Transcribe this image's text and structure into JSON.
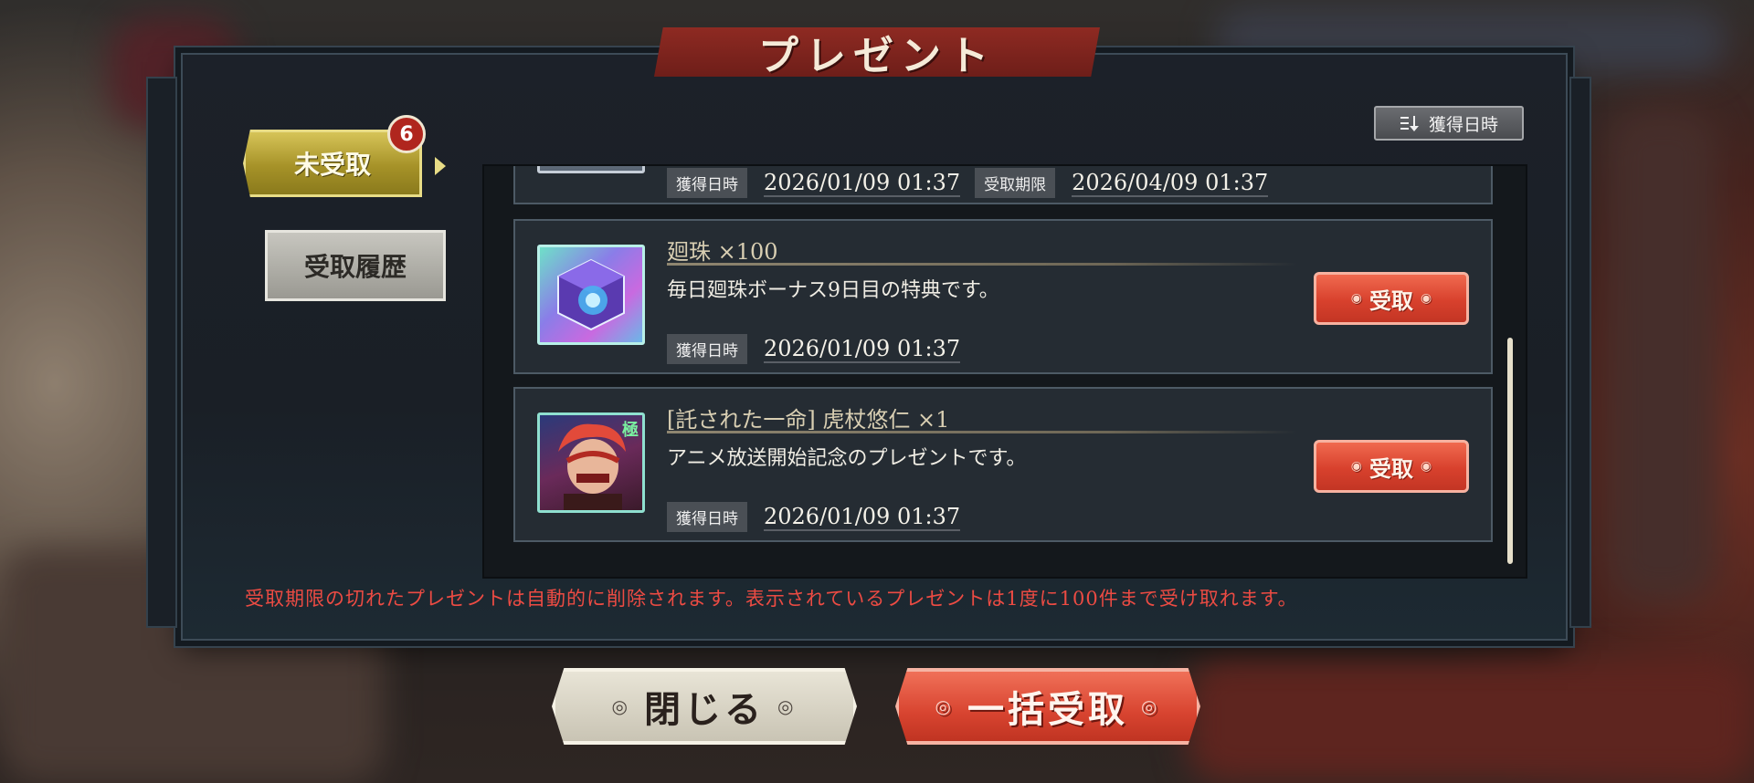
{
  "window": {
    "title": "プレゼント"
  },
  "tabs": {
    "unreceived": {
      "label": "未受取",
      "badge_count": "6"
    },
    "history": {
      "label": "受取履歴"
    }
  },
  "sort": {
    "label": "獲得日時",
    "icon": "sort-icon"
  },
  "items": [
    {
      "title": "",
      "description": "",
      "acquired_label": "獲得日時",
      "acquired_value": "2026/01/09 01:37",
      "expiry_label": "受取期限",
      "expiry_value": "2026/04/09 01:37"
    },
    {
      "title": "廻珠 ×100",
      "description": "毎日廻珠ボーナス9日目の特典です。",
      "acquired_label": "獲得日時",
      "acquired_value": "2026/01/09 01:37",
      "receive_label": "受取",
      "icon": "cursed-orb-icon"
    },
    {
      "title": "[託された一命] 虎杖悠仁 ×1",
      "description": "アニメ放送開始記念のプレゼントです。",
      "acquired_label": "獲得日時",
      "acquired_value": "2026/01/09 01:37",
      "receive_label": "受取",
      "icon": "character-portrait-icon",
      "corner_tag": "極"
    }
  ],
  "notice": "受取期限の切れたプレゼントは自動的に削除されます。表示されているプレゼントは1度に100件まで受け取れます。",
  "buttons": {
    "close": "閉じる",
    "receive_all": "一括受取"
  },
  "colors": {
    "accent_red": "#d8412d",
    "tab_gold": "#a69228",
    "notice_red": "#ec4b43"
  }
}
